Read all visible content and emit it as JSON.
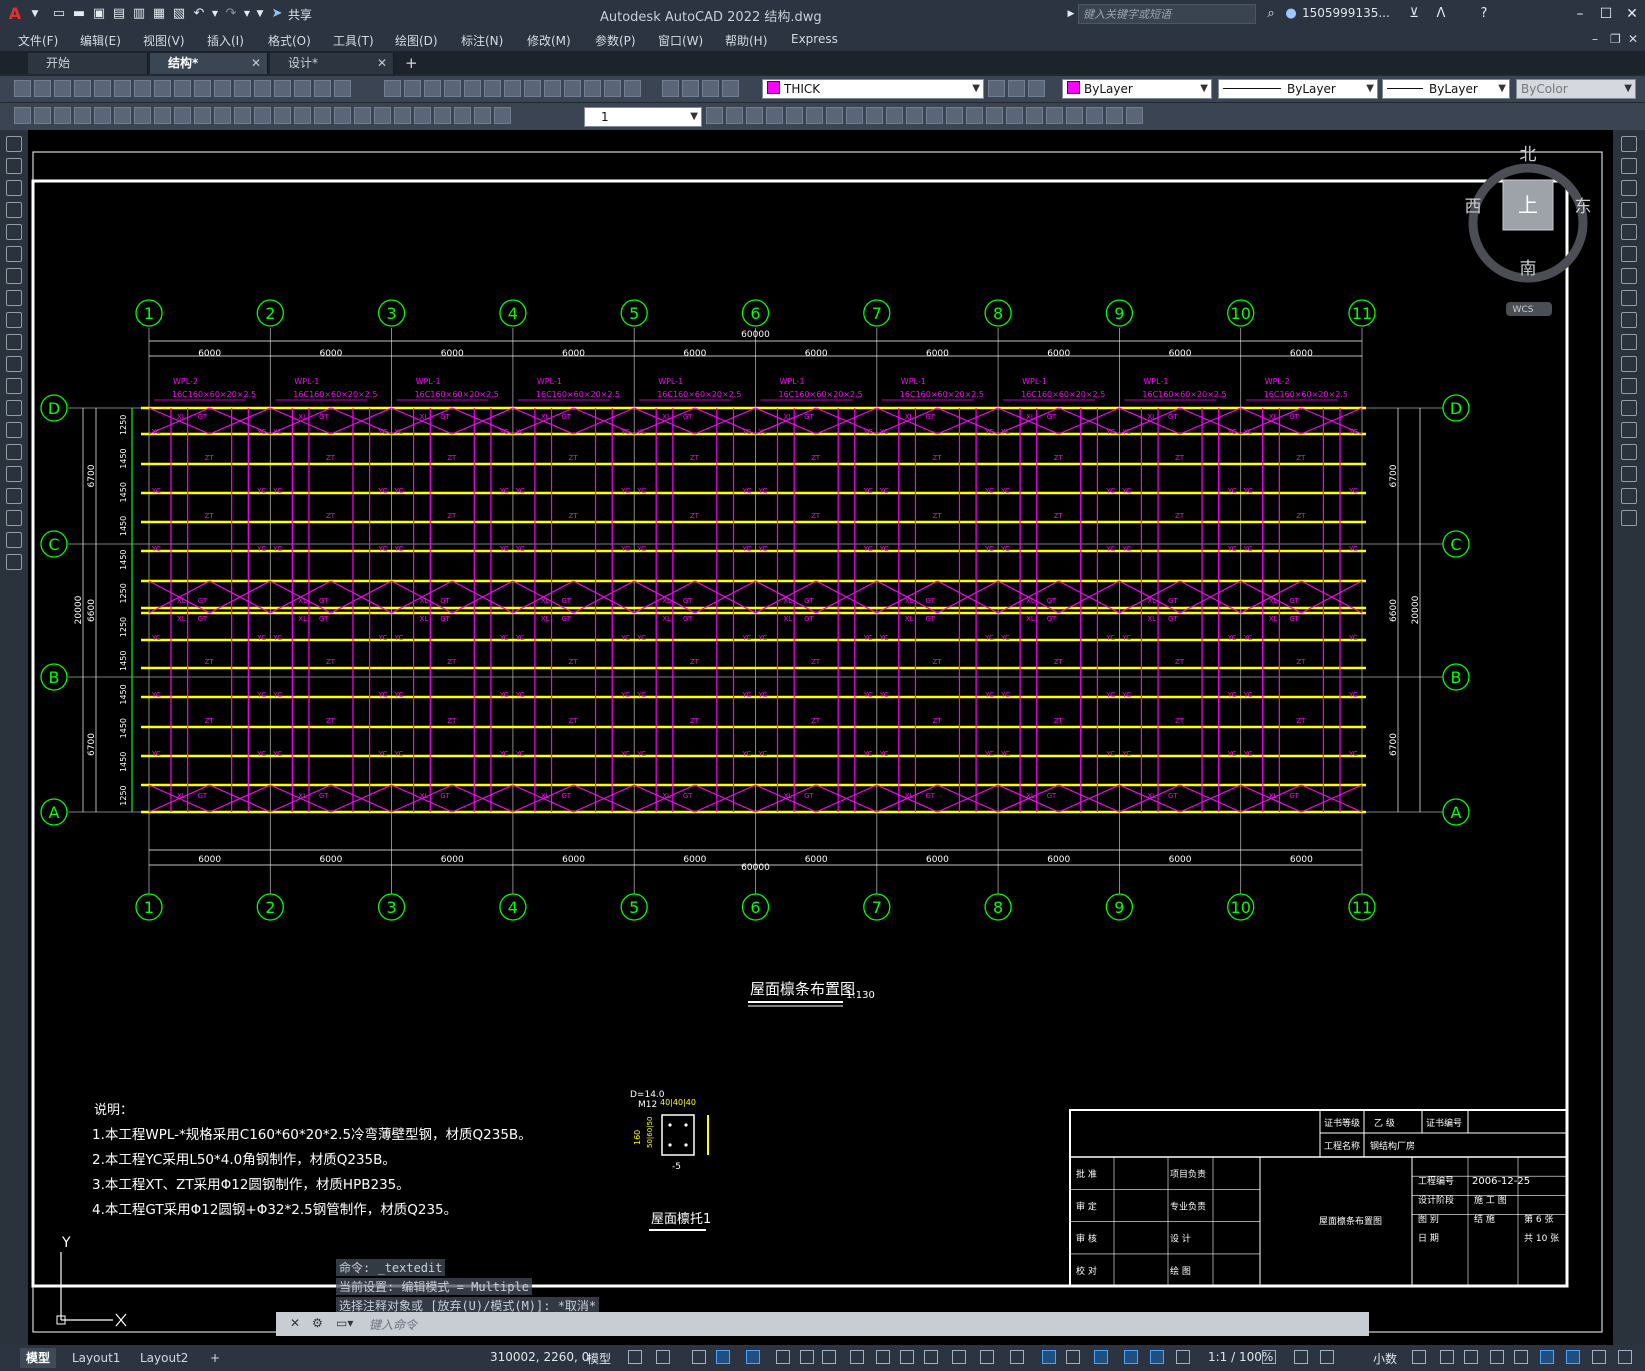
{
  "title_bar": {
    "app_title": "Autodesk AutoCAD 2022    结构.dwg",
    "share_label": "共享",
    "search_placeholder": "键入关键字或短语",
    "user": "1505999135...",
    "logo": "A"
  },
  "menu": [
    "文件(F)",
    "编辑(E)",
    "视图(V)",
    "插入(I)",
    "格式(O)",
    "工具(T)",
    "绘图(D)",
    "标注(N)",
    "修改(M)",
    "参数(P)",
    "窗口(W)",
    "帮助(H)",
    "Express"
  ],
  "tabs": [
    {
      "label": "开始",
      "active": false,
      "closable": false
    },
    {
      "label": "结构*",
      "active": true,
      "closable": true
    },
    {
      "label": "设计*",
      "active": false,
      "closable": true
    }
  ],
  "tab_add": "+",
  "toolbar": {
    "layer": "THICK",
    "color": "ByLayer",
    "linetype": "ByLayer",
    "lineweight": "ByLayer",
    "plotstyle": "ByColor",
    "dimstyle_value": "1"
  },
  "viewcube": {
    "north": "北",
    "south": "南",
    "east": "东",
    "west": "西",
    "top": "上",
    "wcs": "WCS"
  },
  "drawing": {
    "grid_numbers": [
      "1",
      "2",
      "3",
      "4",
      "5",
      "6",
      "7",
      "8",
      "9",
      "10",
      "11"
    ],
    "grid_letters": [
      "D",
      "C",
      "B",
      "A"
    ],
    "bay_dim": "6000",
    "total_dim": "60000",
    "side_dims_left": [
      "6700",
      "6600",
      "6700"
    ],
    "side_total": "20000",
    "purlin_spacing": [
      "1250",
      "1450",
      "1450",
      "1450",
      "1450",
      "1250",
      "1250",
      "1450",
      "1450",
      "1450",
      "1450",
      "1250"
    ],
    "beam_labels": [
      "WPL-2",
      "WPL-1",
      "WPL-1",
      "WPL-1",
      "WPL-1",
      "WPL-1",
      "WPL-1",
      "WPL-1",
      "WPL-1",
      "WPL-2"
    ],
    "beam_spec": "16C160×60×20×2.5",
    "member_labels": {
      "yc": "YC",
      "zt": "ZT",
      "xl": "XL",
      "gt": "GT"
    },
    "plan_title": "屋面檩条布置图",
    "plan_scale": "1:130",
    "detail_title": "屋面檩托1",
    "detail_notes": {
      "d": "D=14.0",
      "m": "M12",
      "dims": "40|40|40",
      "h": "160",
      "h2": "50|60|50",
      "plate": "-5"
    },
    "notes_title": "说明：",
    "notes": [
      "1.本工程WPL-*规格采用C160*60*20*2.5冷弯薄壁型钢，材质Q235B。",
      "2.本工程YC采用L50*4.0角钢制作，材质Q235B。",
      "3.本工程XT、ZT采用Φ12圆钢制作，材质HPB235。",
      "4.本工程GT采用Φ12圆钢+Φ32*2.5钢管制作，材质Q235。"
    ],
    "title_block": {
      "cert_level": "证书等级",
      "level_value": "乙  级",
      "cert_no": "证书编号",
      "project_name_label": "工程名称",
      "project_name": "钢结构厂房",
      "roles_left": [
        "批  准",
        "审  定",
        "审  核",
        "校  对"
      ],
      "roles_mid": [
        "项目负责",
        "专业负责",
        "设  计",
        "绘  图"
      ],
      "drawing_name": "屋面檩条布置图",
      "proj_no_label": "工程编号",
      "date": "2006-12-25",
      "stage_label": "设计阶段",
      "stage_value": "施 工 图",
      "sheet_label": "图  别",
      "sheet_value": "结  施",
      "sheet_no": "第 6 张",
      "date_label": "日  期",
      "total": "共 10 张"
    }
  },
  "ucs": {
    "y": "Y"
  },
  "command_history": [
    "命令: _textedit",
    "当前设置: 编辑模式 = Multiple",
    "选择注释对象或 [放弃(U)/模式(M)]: *取消*"
  ],
  "command_placeholder": "键入命令",
  "status": {
    "tabs": [
      "模型",
      "Layout1",
      "Layout2"
    ],
    "add": "+",
    "coords": "310002, 2260, 0",
    "model": "模型",
    "scale": "1:1 / 100%",
    "units": "小数"
  },
  "colors": {
    "yellow": "#ffff00",
    "magenta": "#ff00ff",
    "green": "#00ff00",
    "white": "#ffffff",
    "grey": "#a9a9a9"
  }
}
